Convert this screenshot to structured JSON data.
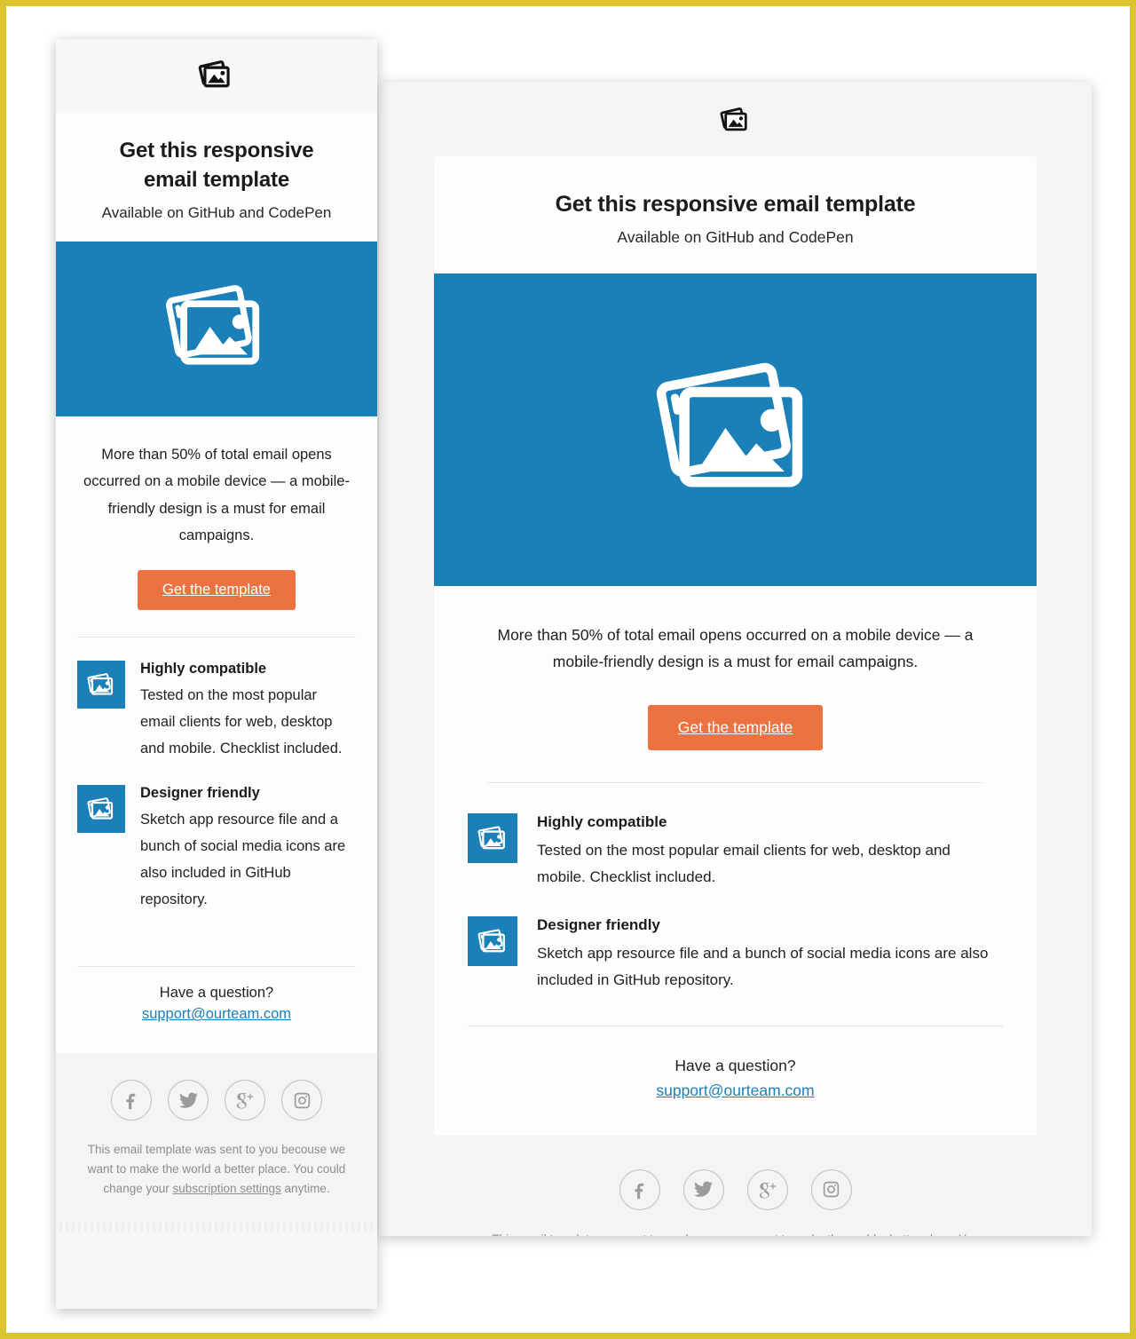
{
  "colors": {
    "brand_blue": "#1b7fb8",
    "cta_orange": "#ec7241",
    "link_blue": "#1b7fb8",
    "muted_gray": "#8d8d8d",
    "page_border_yellow": "#dcc430",
    "card_bg": "#fdfdfd",
    "panel_bg": "#f4f4f4"
  },
  "email": {
    "logo_icon": "photos-icon",
    "heading": "Get this responsive email template",
    "subheading": "Available on GitHub and CodePen",
    "hero_icon": "photos-icon",
    "lede": "More than 50% of total email opens occurred on a mobile device — a mobile-friendly design is a must for email campaigns.",
    "cta_label": "Get the template",
    "features": [
      {
        "icon": "photos-icon",
        "title": "Highly compatible",
        "body": "Tested on the most popular email clients for web, desktop and mobile. Checklist included."
      },
      {
        "icon": "photos-icon",
        "title": "Designer friendly",
        "body": "Sketch app resource file and a bunch of social media icons are also included in GitHub repository."
      }
    ],
    "question_label": "Have a question?",
    "support_email": "support@ourteam.com",
    "social": [
      {
        "name": "facebook-icon",
        "glyph": "f"
      },
      {
        "name": "twitter-icon",
        "glyph": "twitter"
      },
      {
        "name": "google-plus-icon",
        "glyph": "g+"
      },
      {
        "name": "instagram-icon",
        "glyph": "instagram"
      }
    ],
    "legal_part1": "This email template was sent to you becouse we want to make the world a better place. You could change your ",
    "legal_link": "subscription settings",
    "legal_part2": " anytime."
  },
  "mobile": {
    "heading_line1": "Get this responsive",
    "heading_line2": "email template"
  }
}
